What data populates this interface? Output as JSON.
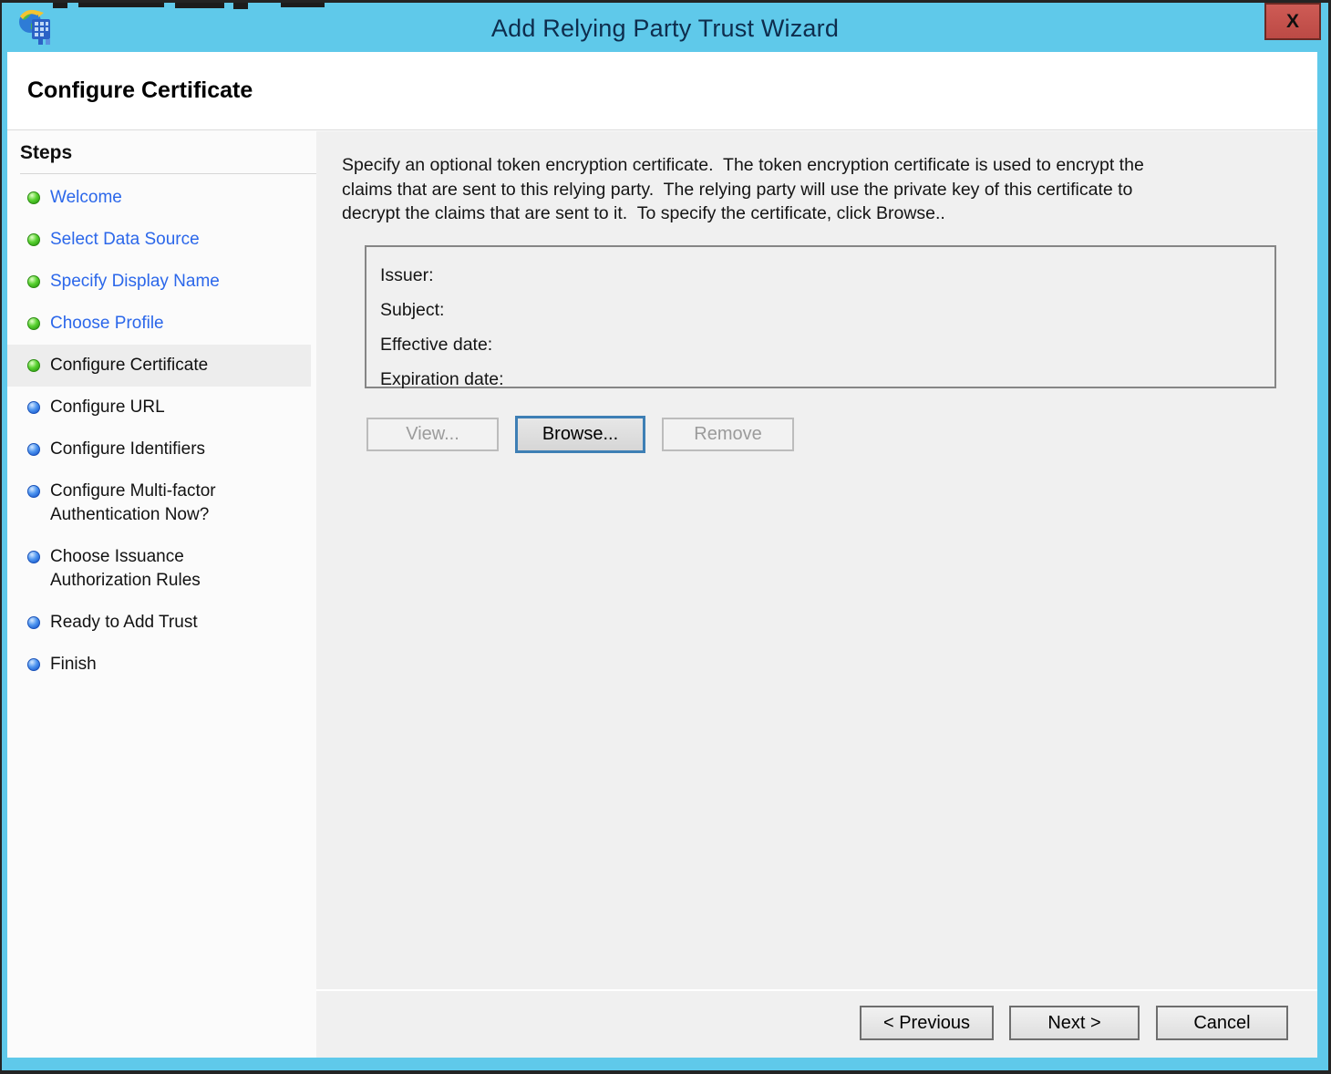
{
  "window": {
    "title": "Add Relying Party Trust Wizard",
    "close_glyph": "X"
  },
  "page": {
    "title": "Configure Certificate"
  },
  "steps": {
    "heading": "Steps",
    "items": [
      {
        "label": "Welcome",
        "state": "completed"
      },
      {
        "label": "Select Data Source",
        "state": "completed"
      },
      {
        "label": "Specify Display Name",
        "state": "completed"
      },
      {
        "label": "Choose Profile",
        "state": "completed"
      },
      {
        "label": "Configure Certificate",
        "state": "current"
      },
      {
        "label": "Configure URL",
        "state": "upcoming"
      },
      {
        "label": "Configure Identifiers",
        "state": "upcoming"
      },
      {
        "label": "Configure Multi-factor\nAuthentication Now?",
        "state": "upcoming"
      },
      {
        "label": "Choose Issuance\nAuthorization Rules",
        "state": "upcoming"
      },
      {
        "label": "Ready to Add Trust",
        "state": "upcoming"
      },
      {
        "label": "Finish",
        "state": "upcoming"
      }
    ]
  },
  "content": {
    "description": "Specify an optional token encryption certificate.  The token encryption certificate is used to encrypt the\nclaims that are sent to this relying party.  The relying party will use the private key of this certificate to\ndecrypt the claims that are sent to it.  To specify the certificate, click Browse..",
    "certificate": {
      "fields": [
        {
          "label": "Issuer:",
          "value": ""
        },
        {
          "label": "Subject:",
          "value": ""
        },
        {
          "label": "Effective date:",
          "value": ""
        },
        {
          "label": "Expiration date:",
          "value": ""
        }
      ]
    },
    "actions": {
      "view": {
        "label": "View...",
        "enabled": false
      },
      "browse": {
        "label": "Browse...",
        "enabled": true,
        "focused": true
      },
      "remove": {
        "label": "Remove",
        "enabled": false
      }
    }
  },
  "footer": {
    "previous": "< Previous",
    "next": "Next >",
    "cancel": "Cancel"
  },
  "colors": {
    "titlebar_blue": "#5FC9EA",
    "close_red": "#C7534F",
    "link_blue": "#2B67EA",
    "completed_bullet_green": "#3CBE1E",
    "upcoming_bullet_blue": "#2F7BE0",
    "content_gray": "#F0F0F0",
    "current_step_highlight": "#EDEDED",
    "focus_border_blue": "#3E7FB5"
  }
}
